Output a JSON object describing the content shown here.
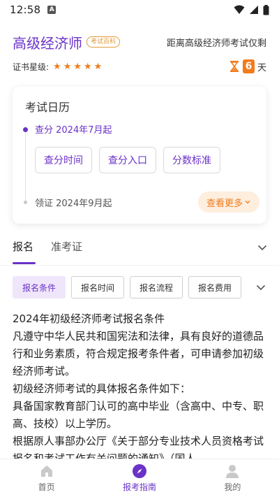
{
  "status_bar": {
    "time": "12:58",
    "notif_icon": "a-icon"
  },
  "header": {
    "title": "高级经济师",
    "tag": "考试百科",
    "countdown_label": "距离高级经济师考试仅剩"
  },
  "rating": {
    "label": "证书星级:",
    "stars": 5,
    "days_value": "6",
    "days_unit": "天"
  },
  "calendar": {
    "title": "考试日历",
    "step1": "查分 2024年7月起",
    "actions": [
      "查分时间",
      "查分入口",
      "分数标准"
    ],
    "step2": "领证 2024年9月起",
    "more": "查看更多"
  },
  "tabs": {
    "items": [
      "报名",
      "准考证"
    ],
    "active": 0
  },
  "chips": {
    "items": [
      "报名条件",
      "报名时间",
      "报名流程",
      "报名费用"
    ],
    "active": 0
  },
  "content": {
    "paragraphs": [
      "2024年初级经济师考试报名条件",
      "凡遵守中华人民共和国宪法和法律，具有良好的道德品行和业务素质，符合规定报考条件者，可申请参加初级经济师考试。",
      "初级经济师考试的具体报名条件如下：",
      "具备国家教育部门认可的高中毕业（含高中、中专、职高、技校）以上学历。",
      "根据原人事部办公厅《关于部分专业技术人员资格考试报名和考试工作有关问题的通知》（国人"
    ]
  },
  "bottom_nav": {
    "items": [
      "首页",
      "报考指南",
      "我的"
    ],
    "active": 1
  },
  "colors": {
    "accent": "#6b32c8",
    "orange": "#f07c1c"
  }
}
